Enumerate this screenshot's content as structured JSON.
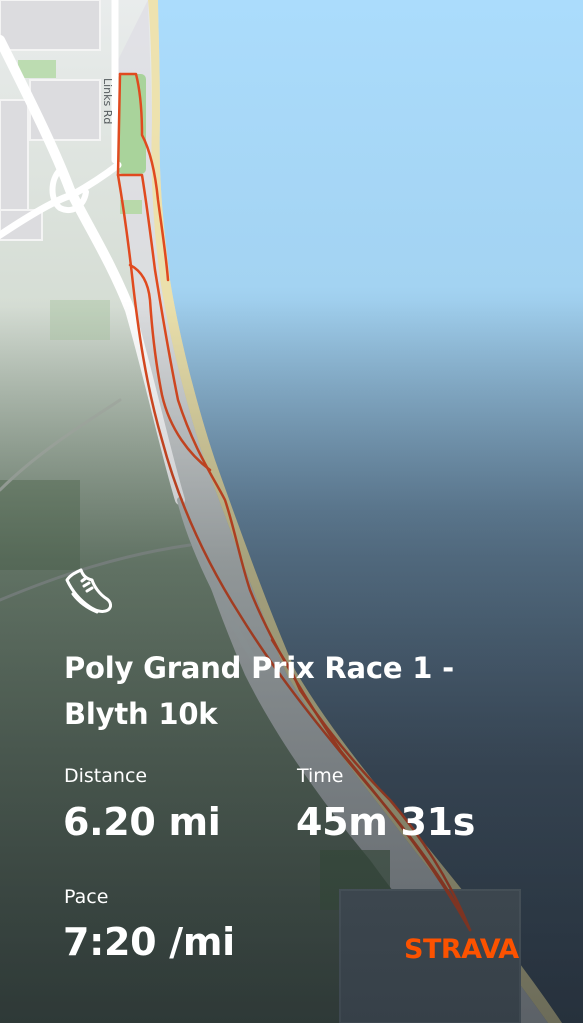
{
  "map": {
    "street_label": "Links Rd"
  },
  "activity": {
    "title": "Poly Grand Prix Race 1 - Blyth 10k",
    "icon": "shoe-icon"
  },
  "stats": {
    "distance_label": "Distance",
    "distance_value": "6.20 mi",
    "time_label": "Time",
    "time_value": "45m 31s",
    "pace_label": "Pace",
    "pace_value": "7:20 /mi"
  },
  "brand": {
    "logo_text": "STRAVA",
    "accent_color": "#fc5200"
  },
  "colors": {
    "sea_top": "#a9dcfc",
    "sea_bottom": "#3d4c5a",
    "route": "#e04a1f",
    "sand": "#f0e3a2"
  }
}
